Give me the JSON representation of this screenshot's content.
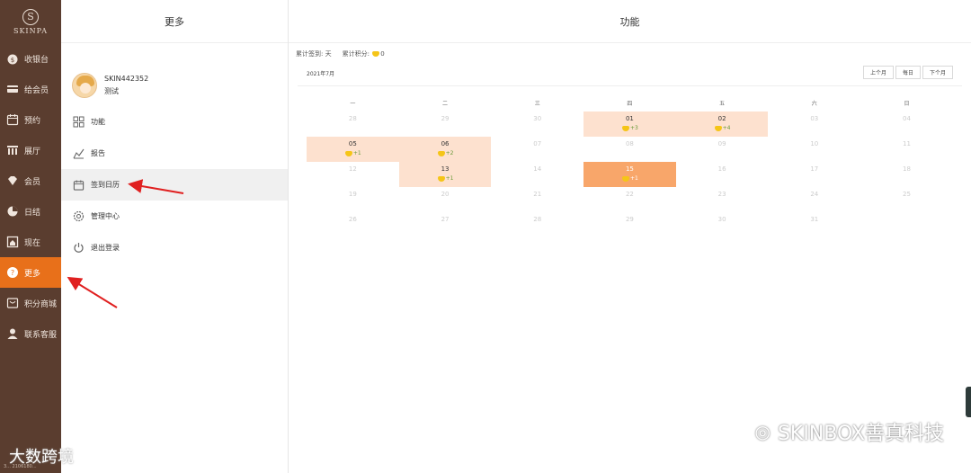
{
  "logo": {
    "brand": "SKINPA"
  },
  "nav": [
    {
      "label": "收银台",
      "icon": "money-bag-icon"
    },
    {
      "label": "给会员",
      "icon": "card-icon"
    },
    {
      "label": "预约",
      "icon": "calendar-icon"
    },
    {
      "label": "展厅",
      "icon": "building-icon"
    },
    {
      "label": "会员",
      "icon": "diamond-icon"
    },
    {
      "label": "日结",
      "icon": "pie-icon"
    },
    {
      "label": "现在",
      "icon": "home-icon"
    },
    {
      "label": "更多",
      "icon": "help-icon"
    },
    {
      "label": "积分商城",
      "icon": "store-icon"
    },
    {
      "label": "联系客服",
      "icon": "person-icon"
    }
  ],
  "nav_footer": "3... 2106180...",
  "mid": {
    "title": "更多",
    "user": {
      "name": "SKIN442352",
      "role": "测试"
    },
    "menu": [
      {
        "label": "功能",
        "icon": "grid-icon"
      },
      {
        "label": "报告",
        "icon": "chart-icon"
      },
      {
        "label": "签到日历",
        "icon": "calendar-icon"
      },
      {
        "label": "管理中心",
        "icon": "gear-icon"
      },
      {
        "label": "退出登录",
        "icon": "power-icon"
      }
    ]
  },
  "main": {
    "title": "功能",
    "stats": {
      "days_label": "累计签到:",
      "days_value": "天",
      "points_label": "累计积分:",
      "points_value": "0"
    },
    "month": "2021年7月",
    "buttons": {
      "prev": "上个月",
      "current": "每日",
      "next": "下个月"
    },
    "weekdays": [
      "一",
      "二",
      "三",
      "四",
      "五",
      "六",
      "日"
    ],
    "weeks": [
      [
        {
          "d": "28"
        },
        {
          "d": "29"
        },
        {
          "d": "30"
        },
        {
          "d": "01",
          "cur": true,
          "signed": true,
          "pts": "+3"
        },
        {
          "d": "02",
          "cur": true,
          "signed": true,
          "pts": "+4"
        },
        {
          "d": "03"
        },
        {
          "d": "04"
        }
      ],
      [
        {
          "d": "05",
          "cur": true,
          "signed": true,
          "pts": "+1"
        },
        {
          "d": "06",
          "cur": true,
          "signed": true,
          "pts": "+2"
        },
        {
          "d": "07"
        },
        {
          "d": "08"
        },
        {
          "d": "09"
        },
        {
          "d": "10"
        },
        {
          "d": "11"
        }
      ],
      [
        {
          "d": "12"
        },
        {
          "d": "13",
          "cur": true,
          "signed": true,
          "pts": "+1"
        },
        {
          "d": "14"
        },
        {
          "d": "15",
          "cur": true,
          "today": true,
          "pts": "+1"
        },
        {
          "d": "16"
        },
        {
          "d": "17"
        },
        {
          "d": "18"
        }
      ],
      [
        {
          "d": "19"
        },
        {
          "d": "20"
        },
        {
          "d": "21"
        },
        {
          "d": "22"
        },
        {
          "d": "23"
        },
        {
          "d": "24"
        },
        {
          "d": "25"
        }
      ],
      [
        {
          "d": "26"
        },
        {
          "d": "27"
        },
        {
          "d": "28"
        },
        {
          "d": "29"
        },
        {
          "d": "30"
        },
        {
          "d": "31"
        },
        {
          "d": ""
        }
      ]
    ]
  },
  "watermark": {
    "right": "SKINBOX善真科技",
    "left": "大数跨境"
  },
  "colors": {
    "sidebar": "#5a3d2f",
    "accent": "#e8701a",
    "signed": "#fde1cf",
    "today": "#f8a66a",
    "arrow": "#e02020"
  }
}
